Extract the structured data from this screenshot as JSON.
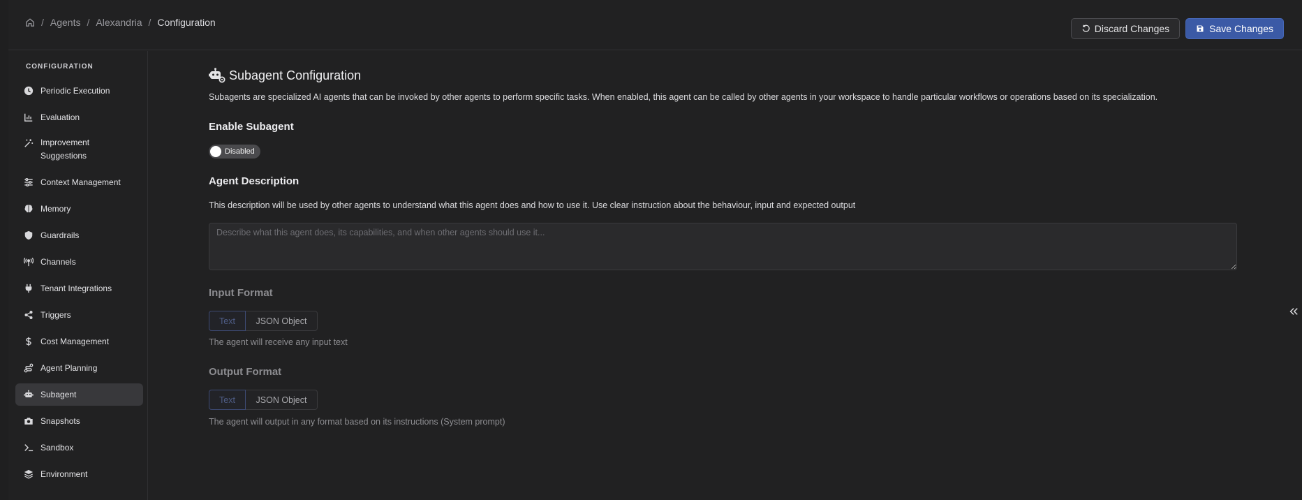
{
  "breadcrumb": {
    "items": [
      "Agents",
      "Alexandria"
    ],
    "current": "Configuration",
    "separator": "/"
  },
  "header": {
    "discard_label": "Discard Changes",
    "save_label": "Save Changes"
  },
  "sidebar": {
    "title": "CONFIGURATION",
    "items": [
      {
        "label": "Periodic Execution",
        "icon": "clock-icon"
      },
      {
        "label": "Evaluation",
        "icon": "bar-chart-icon"
      },
      {
        "label": "Improvement Suggestions",
        "icon": "magic-wand-icon"
      },
      {
        "label": "Context Management",
        "icon": "sliders-icon"
      },
      {
        "label": "Memory",
        "icon": "brain-icon"
      },
      {
        "label": "Guardrails",
        "icon": "shield-icon"
      },
      {
        "label": "Channels",
        "icon": "antenna-icon"
      },
      {
        "label": "Tenant Integrations",
        "icon": "plug-icon"
      },
      {
        "label": "Triggers",
        "icon": "share-nodes-icon"
      },
      {
        "label": "Cost Management",
        "icon": "dollar-icon"
      },
      {
        "label": "Agent Planning",
        "icon": "route-icon"
      },
      {
        "label": "Subagent",
        "icon": "robot-icon",
        "active": true
      },
      {
        "label": "Snapshots",
        "icon": "camera-icon"
      },
      {
        "label": "Sandbox",
        "icon": "terminal-icon"
      },
      {
        "label": "Environment",
        "icon": "layers-icon"
      }
    ]
  },
  "main": {
    "title": "Subagent Configuration",
    "description": "Subagents are specialized AI agents that can be invoked by other agents to perform specific tasks. When enabled, this agent can be called by other agents in your workspace to handle particular workflows or operations based on its specialization.",
    "enable_label": "Enable Subagent",
    "toggle_state": "Disabled",
    "agent_desc_label": "Agent Description",
    "agent_desc_help": "This description will be used by other agents to understand what this agent does and how to use it. Use clear instruction about the behaviour, input and expected output",
    "agent_desc_placeholder": "Describe what this agent does, its capabilities, and when other agents should use it...",
    "agent_desc_value": "",
    "input_format_label": "Input Format",
    "input_options": [
      "Text",
      "JSON Object"
    ],
    "input_selected": "Text",
    "input_help": "The agent will receive any input text",
    "output_format_label": "Output Format",
    "output_options": [
      "Text",
      "JSON Object"
    ],
    "output_selected": "Text",
    "output_help": "The agent will output in any format based on its instructions (System prompt)"
  },
  "colors": {
    "background": "#212122",
    "primary_button": "#3b5aa6",
    "active_nav": "#38383b"
  }
}
